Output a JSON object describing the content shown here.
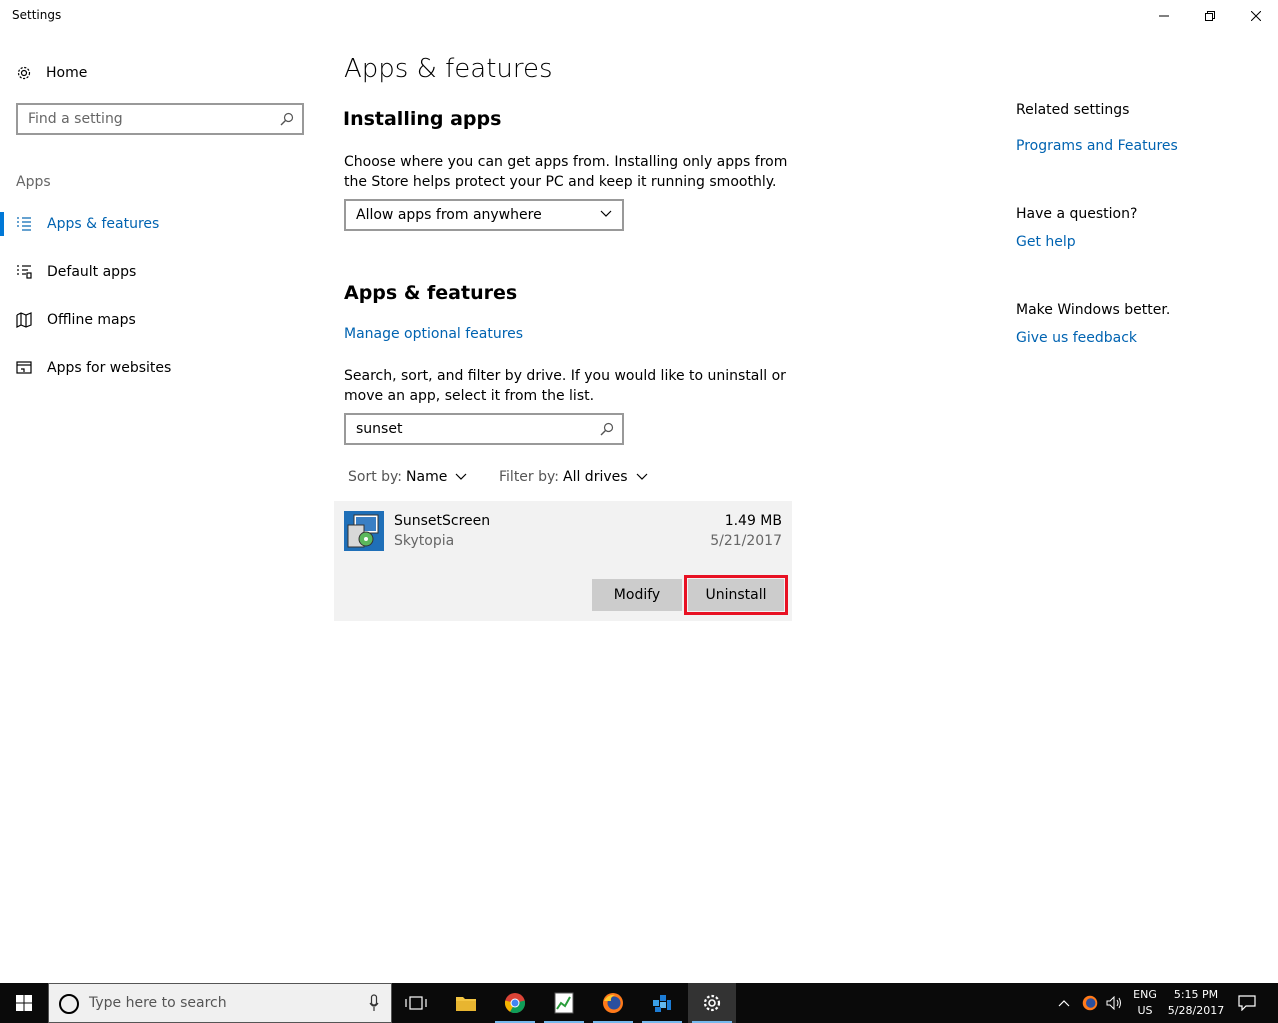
{
  "window": {
    "title": "Settings"
  },
  "sidebar": {
    "home_label": "Home",
    "search_placeholder": "Find a setting",
    "section_label": "Apps",
    "items": [
      {
        "label": "Apps & features",
        "active": true
      },
      {
        "label": "Default apps"
      },
      {
        "label": "Offline maps"
      },
      {
        "label": "Apps for websites"
      }
    ]
  },
  "main": {
    "page_title": "Apps & features",
    "installing": {
      "heading": "Installing apps",
      "description": "Choose where you can get apps from. Installing only apps from the Store helps protect your PC and keep it running smoothly.",
      "dropdown_value": "Allow apps from anywhere"
    },
    "features": {
      "heading": "Apps & features",
      "manage_link": "Manage optional features",
      "description": "Search, sort, and filter by drive. If you would like to uninstall or move an app, select it from the list.",
      "search_value": "sunset",
      "sort_label": "Sort by:",
      "sort_value": "Name",
      "filter_label": "Filter by:",
      "filter_value": "All drives"
    },
    "app": {
      "name": "SunsetScreen",
      "publisher": "Skytopia",
      "size": "1.49 MB",
      "date": "5/21/2017",
      "modify_label": "Modify",
      "uninstall_label": "Uninstall"
    }
  },
  "related": {
    "heading": "Related settings",
    "programs_link": "Programs and Features",
    "question_heading": "Have a question?",
    "help_link": "Get help",
    "better_heading": "Make Windows better.",
    "feedback_link": "Give us feedback"
  },
  "taskbar": {
    "search_placeholder": "Type here to search",
    "lang_top": "ENG",
    "lang_bottom": "US",
    "time": "5:15 PM",
    "date": "5/28/2017"
  },
  "colors": {
    "accent": "#0078d7",
    "link": "#0063b1",
    "highlight": "#e81123"
  }
}
